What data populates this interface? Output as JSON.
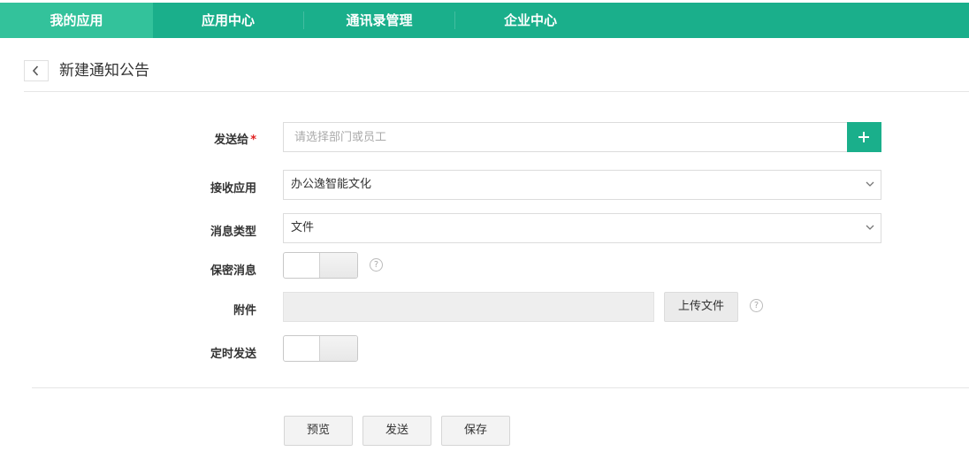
{
  "nav": {
    "items": [
      {
        "label": "我的应用",
        "active": true
      },
      {
        "label": "应用中心",
        "active": false
      },
      {
        "label": "通讯录管理",
        "active": false
      },
      {
        "label": "企业中心",
        "active": false
      }
    ]
  },
  "header": {
    "title": "新建通知公告"
  },
  "form": {
    "send_to": {
      "label": "发送给",
      "required_mark": "*",
      "placeholder": "请选择部门或员工"
    },
    "receive_app": {
      "label": "接收应用",
      "value": "办公逸智能文化"
    },
    "message_type": {
      "label": "消息类型",
      "value": "文件"
    },
    "confidential": {
      "label": "保密消息",
      "help": "?"
    },
    "attachment": {
      "label": "附件",
      "upload_label": "上传文件",
      "help": "?"
    },
    "scheduled": {
      "label": "定时发送"
    }
  },
  "actions": {
    "preview": "预览",
    "send": "发送",
    "save": "保存"
  },
  "colors": {
    "accent": "#1aaf8b",
    "active_tab": "#33c29b",
    "required": "#e02020"
  }
}
